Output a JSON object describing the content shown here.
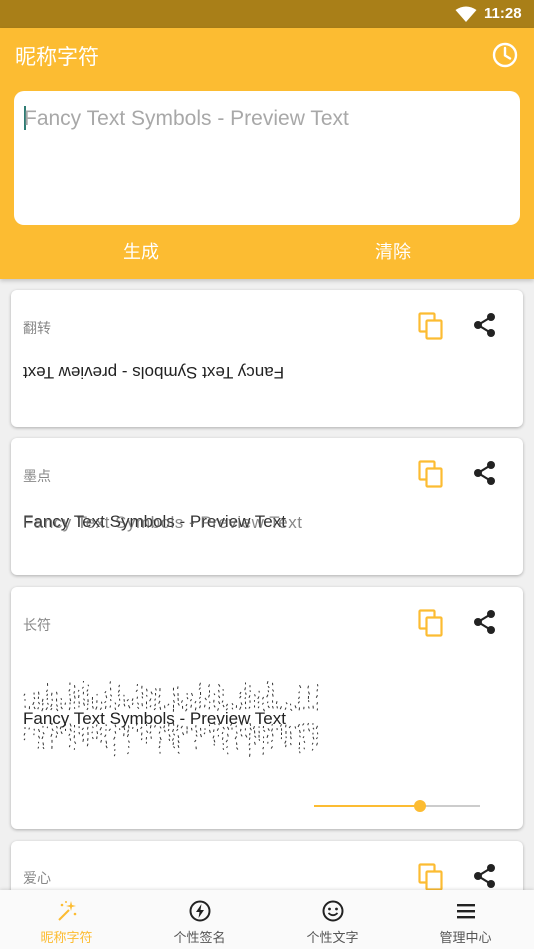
{
  "status_bar": {
    "time": "11:28"
  },
  "app": {
    "title": "昵称字符",
    "input_placeholder": "Fancy Text Symbols - Preview Text",
    "generate_label": "生成",
    "clear_label": "清除"
  },
  "cards": [
    {
      "label": "翻转",
      "text": "Fancy Text Symbols - preview Text"
    },
    {
      "label": "墨点",
      "text": "Fancy Text Symbols - Preview Text"
    },
    {
      "label": "长符",
      "text": "Fancy Text Symbols - Preview Text",
      "slider_value": 0.64
    },
    {
      "label": "爱心"
    }
  ],
  "nav": [
    {
      "label": "昵称字符",
      "icon": "magic-wand-icon",
      "active": true
    },
    {
      "label": "个性签名",
      "icon": "lightning-icon"
    },
    {
      "label": "个性文字",
      "icon": "smiley-icon"
    },
    {
      "label": "管理中心",
      "icon": "menu-icon"
    }
  ],
  "colors": {
    "accent": "#fcbc32",
    "status_bar": "#a97f18"
  }
}
